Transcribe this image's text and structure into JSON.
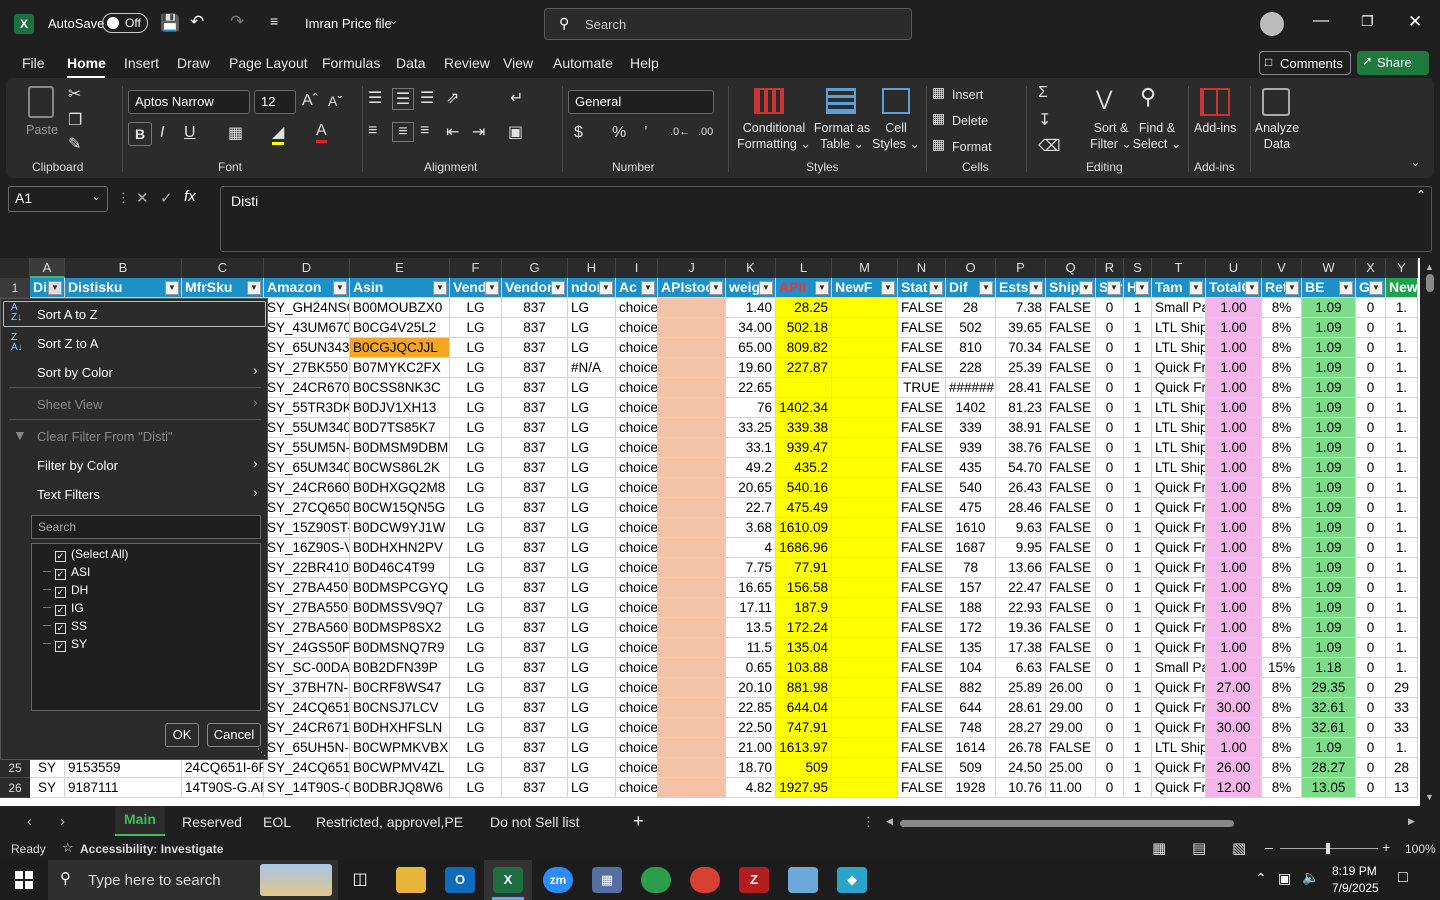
{
  "title": {
    "autosave": "AutoSave",
    "autosave_state": "Off",
    "filename": "Imran Price file",
    "search_placeholder": "Search"
  },
  "menu": [
    "File",
    "Home",
    "Insert",
    "Draw",
    "Page Layout",
    "Formulas",
    "Data",
    "Review",
    "View",
    "Automate",
    "Help"
  ],
  "actions": {
    "comments": "Comments",
    "share": "Share"
  },
  "ribbon": {
    "clipboard": {
      "paste": "Paste",
      "group": "Clipboard"
    },
    "font": {
      "name": "Aptos Narrow",
      "size": "12",
      "group": "Font"
    },
    "alignment": {
      "group": "Alignment"
    },
    "number": {
      "format": "General",
      "group": "Number"
    },
    "styles": {
      "cond1": "Conditional",
      "cond2": "Formatting",
      "fat1": "Format as",
      "fat2": "Table",
      "cs1": "Cell",
      "cs2": "Styles",
      "group": "Styles"
    },
    "cells": {
      "insert": "Insert",
      "delete": "Delete",
      "format": "Format",
      "group": "Cells"
    },
    "editing": {
      "sf1": "Sort &",
      "sf2": "Filter",
      "fs1": "Find &",
      "fs2": "Select",
      "group": "Editing"
    },
    "addins": {
      "label": "Add-ins",
      "group": "Add-ins"
    },
    "analyze": {
      "l1": "Analyze",
      "l2": "Data"
    }
  },
  "formula": {
    "namebox": "A1",
    "content": "Disti"
  },
  "columns": [
    {
      "l": "A",
      "w": 35,
      "h": "Dis"
    },
    {
      "l": "B",
      "w": 117,
      "h": "Distisku"
    },
    {
      "l": "C",
      "w": 82,
      "h": "MfrSku"
    },
    {
      "l": "D",
      "w": 86,
      "h": "Amazon"
    },
    {
      "l": "E",
      "w": 100,
      "h": "Asin"
    },
    {
      "l": "F",
      "w": 52,
      "h": "Vend"
    },
    {
      "l": "G",
      "w": 66,
      "h": "Vendor"
    },
    {
      "l": "H",
      "w": 48,
      "h": "ndor"
    },
    {
      "l": "I",
      "w": 42,
      "h": "Ac"
    },
    {
      "l": "J",
      "w": 68,
      "h": "APIstoc"
    },
    {
      "l": "K",
      "w": 50,
      "h": "weig"
    },
    {
      "l": "L",
      "w": 56,
      "h": "APII"
    },
    {
      "l": "M",
      "w": 66,
      "h": "NewF"
    },
    {
      "l": "N",
      "w": 48,
      "h": "Stat"
    },
    {
      "l": "O",
      "w": 50,
      "h": "Dif"
    },
    {
      "l": "P",
      "w": 50,
      "h": "Ests"
    },
    {
      "l": "Q",
      "w": 50,
      "h": "Ship"
    },
    {
      "l": "R",
      "w": 28,
      "h": "Sur"
    },
    {
      "l": "S",
      "w": 28,
      "h": "H"
    },
    {
      "l": "T",
      "w": 54,
      "h": "Tam"
    },
    {
      "l": "U",
      "w": 56,
      "h": "TotalC"
    },
    {
      "l": "V",
      "w": 40,
      "h": "Ref"
    },
    {
      "l": "W",
      "w": 54,
      "h": "BE"
    },
    {
      "l": "X",
      "w": 30,
      "h": "GI"
    },
    {
      "l": "Y",
      "w": 32,
      "h": "New"
    }
  ],
  "rows": [
    {
      "n": "2",
      "c": [
        "",
        "",
        "",
        "SY_GH24NSC0",
        "B00MOUBZX0",
        "LG",
        "837",
        "LG",
        "choice",
        "",
        "1.40",
        "28.25",
        "",
        "FALSE",
        "28",
        "7.38",
        "FALSE",
        "0",
        "1",
        "Small Pa",
        "1.00",
        "8%",
        "1.09",
        "0",
        "1."
      ]
    },
    {
      "n": "3",
      "c": [
        "",
        "",
        "",
        "SY_43UM670H",
        "B0CG4V25L2",
        "LG",
        "837",
        "LG",
        "choice",
        "",
        "34.00",
        "502.18",
        "",
        "FALSE",
        "502",
        "39.65",
        "FALSE",
        "0",
        "1",
        "LTL Ship",
        "1.00",
        "8%",
        "1.09",
        "0",
        "1."
      ]
    },
    {
      "n": "4",
      "c": [
        "",
        "",
        "",
        "SY_65UN343H",
        "B0CGJQCJJL",
        "LG",
        "837",
        "LG",
        "choice",
        "",
        "65.00",
        "809.82",
        "",
        "FALSE",
        "810",
        "70.34",
        "FALSE",
        "0",
        "1",
        "LTL Ship",
        "1.00",
        "8%",
        "1.09",
        "0",
        "1."
      ]
    },
    {
      "n": "5",
      "c": [
        "",
        "",
        "",
        "SY_27BK550Y-",
        "B07MYKC2FX",
        "LG",
        "837",
        "#N/A",
        "choice",
        "",
        "19.60",
        "227.87",
        "",
        "FALSE",
        "228",
        "25.39",
        "FALSE",
        "0",
        "1",
        "Quick Fr",
        "1.00",
        "8%",
        "1.09",
        "0",
        "1."
      ]
    },
    {
      "n": "6",
      "c": [
        "",
        "",
        "",
        "SY_24CR670IK",
        "B0CSS8NK3C",
        "LG",
        "837",
        "LG",
        "choice",
        "",
        "22.65",
        "",
        "",
        "TRUE",
        "######",
        "28.41",
        "FALSE",
        "0",
        "1",
        "Quick Fr",
        "1.00",
        "8%",
        "1.09",
        "0",
        "1."
      ]
    },
    {
      "n": "7",
      "c": [
        "",
        "",
        "",
        "SY_55TR3DK-E",
        "B0DJV1XH13",
        "LG",
        "837",
        "LG",
        "choice",
        "",
        "76",
        "1402.34",
        "",
        "FALSE",
        "1402",
        "81.23",
        "FALSE",
        "0",
        "1",
        "LTL Ship",
        "1.00",
        "8%",
        "1.09",
        "0",
        "1."
      ]
    },
    {
      "n": "8",
      "c": [
        "",
        "",
        "",
        "SY_55UM340E",
        "B0D7TS85K7",
        "LG",
        "837",
        "LG",
        "choice",
        "",
        "33.25",
        "339.38",
        "",
        "FALSE",
        "339",
        "38.91",
        "FALSE",
        "0",
        "1",
        "LTL Ship",
        "1.00",
        "8%",
        "1.09",
        "0",
        "1."
      ]
    },
    {
      "n": "9",
      "c": [
        "",
        "",
        "",
        "SY_55UM5N-E",
        "B0DMSM9DBM",
        "LG",
        "837",
        "LG",
        "choice",
        "",
        "33.1",
        "939.47",
        "",
        "FALSE",
        "939",
        "38.76",
        "FALSE",
        "0",
        "1",
        "LTL Ship",
        "1.00",
        "8%",
        "1.09",
        "0",
        "1."
      ]
    },
    {
      "n": "10",
      "c": [
        "",
        "",
        "",
        "SY_65UM340E",
        "B0CWS86L2K",
        "LG",
        "837",
        "LG",
        "choice",
        "",
        "49.2",
        "435.2",
        "",
        "FALSE",
        "435",
        "54.70",
        "FALSE",
        "0",
        "1",
        "LTL Ship",
        "1.00",
        "8%",
        "1.09",
        "0",
        "1."
      ]
    },
    {
      "n": "11",
      "c": [
        "",
        "",
        "",
        "SY_24CR660N",
        "B0DHXGQ2M8",
        "LG",
        "837",
        "LG",
        "choice",
        "",
        "20.65",
        "540.16",
        "",
        "FALSE",
        "540",
        "26.43",
        "FALSE",
        "0",
        "1",
        "Quick Fr",
        "1.00",
        "8%",
        "1.09",
        "0",
        "1."
      ]
    },
    {
      "n": "12",
      "c": [
        "",
        "",
        "",
        "SY_27CQ650N",
        "B0CW15QN5G",
        "LG",
        "837",
        "LG",
        "choice",
        "",
        "22.7",
        "475.49",
        "",
        "FALSE",
        "475",
        "28.46",
        "FALSE",
        "0",
        "1",
        "Quick Fr",
        "1.00",
        "8%",
        "1.09",
        "0",
        "1."
      ]
    },
    {
      "n": "13",
      "c": [
        "",
        "",
        "",
        "SY_15Z90ST-V",
        "B0DCW9YJ1W",
        "LG",
        "837",
        "LG",
        "choice",
        "",
        "3.68",
        "1610.09",
        "",
        "FALSE",
        "1610",
        "9.63",
        "FALSE",
        "0",
        "1",
        "Quick Fr",
        "1.00",
        "8%",
        "1.09",
        "0",
        "1."
      ]
    },
    {
      "n": "14",
      "c": [
        "",
        "",
        "",
        "SY_16Z90S-V.A",
        "B0DHXHN2PV",
        "LG",
        "837",
        "LG",
        "choice",
        "",
        "4",
        "1686.96",
        "",
        "FALSE",
        "1687",
        "9.95",
        "FALSE",
        "0",
        "1",
        "Quick Fr",
        "1.00",
        "8%",
        "1.09",
        "0",
        "1."
      ]
    },
    {
      "n": "15",
      "c": [
        "",
        "",
        "",
        "SY_22BR410-E",
        "B0D46C4T99",
        "LG",
        "837",
        "LG",
        "choice",
        "",
        "7.75",
        "77.91",
        "",
        "FALSE",
        "78",
        "13.66",
        "FALSE",
        "0",
        "1",
        "Quick Fr",
        "1.00",
        "8%",
        "1.09",
        "0",
        "1."
      ]
    },
    {
      "n": "16",
      "c": [
        "",
        "",
        "",
        "SY_27BA450-E",
        "B0DMSPCGYQ",
        "LG",
        "837",
        "LG",
        "choice",
        "",
        "16.65",
        "156.58",
        "",
        "FALSE",
        "157",
        "22.47",
        "FALSE",
        "0",
        "1",
        "Quick Fr",
        "1.00",
        "8%",
        "1.09",
        "0",
        "1."
      ]
    },
    {
      "n": "17",
      "c": [
        "",
        "",
        "",
        "SY_27BA550-E",
        "B0DMSSV9Q7",
        "LG",
        "837",
        "LG",
        "choice",
        "",
        "17.11",
        "187.9",
        "",
        "FALSE",
        "188",
        "22.93",
        "FALSE",
        "0",
        "1",
        "Quick Fr",
        "1.00",
        "8%",
        "1.09",
        "0",
        "1."
      ]
    },
    {
      "n": "18",
      "c": [
        "",
        "",
        "",
        "SY_27BA560-E",
        "B0DMSP8SX2",
        "LG",
        "837",
        "LG",
        "choice",
        "",
        "13.5",
        "172.24",
        "",
        "FALSE",
        "172",
        "19.36",
        "FALSE",
        "0",
        "1",
        "Quick Fr",
        "1.00",
        "8%",
        "1.09",
        "0",
        "1."
      ]
    },
    {
      "n": "19",
      "c": [
        "",
        "",
        "",
        "SY_24GS50FX-",
        "B0DMSNQ7R9",
        "LG",
        "837",
        "LG",
        "choice",
        "",
        "11.5",
        "135.04",
        "",
        "FALSE",
        "135",
        "17.38",
        "FALSE",
        "0",
        "1",
        "Quick Fr",
        "1.00",
        "8%",
        "1.09",
        "0",
        "1."
      ]
    },
    {
      "n": "20",
      "c": [
        "",
        "",
        "",
        "SY_SC-00DA",
        "B0B2DFN39P",
        "LG",
        "837",
        "LG",
        "choice",
        "",
        "0.65",
        "103.88",
        "",
        "FALSE",
        "104",
        "6.63",
        "FALSE",
        "0",
        "1",
        "Small Pa",
        "1.00",
        "15%",
        "1.18",
        "0",
        "1."
      ]
    },
    {
      "n": "21",
      "c": [
        "",
        "",
        "",
        "SY_37BH7N-H",
        "B0CRF8WS47",
        "LG",
        "837",
        "LG",
        "choice",
        "",
        "20.10",
        "881.98",
        "",
        "FALSE",
        "882",
        "25.89",
        "26.00",
        "0",
        "1",
        "Quick Fr",
        "27.00",
        "8%",
        "29.35",
        "0",
        "29"
      ]
    },
    {
      "n": "22",
      "c": [
        "",
        "",
        "",
        "SY_24CQ651W",
        "B0CNSJ7LCV",
        "LG",
        "837",
        "LG",
        "choice",
        "",
        "22.85",
        "644.04",
        "",
        "FALSE",
        "644",
        "28.61",
        "29.00",
        "0",
        "1",
        "Quick Fr",
        "30.00",
        "8%",
        "32.61",
        "0",
        "33"
      ]
    },
    {
      "n": "23",
      "c": [
        "",
        "",
        "",
        "SY_24CR671IK",
        "B0DHXHFSLN",
        "LG",
        "837",
        "LG",
        "choice",
        "",
        "22.50",
        "747.91",
        "",
        "FALSE",
        "748",
        "28.27",
        "29.00",
        "0",
        "1",
        "Quick Fr",
        "30.00",
        "8%",
        "32.61",
        "0",
        "33"
      ]
    },
    {
      "n": "24",
      "c": [
        "",
        "",
        "",
        "SY_65UH5N-E",
        "B0CWPMKVBX",
        "LG",
        "837",
        "LG",
        "choice",
        "",
        "21.00",
        "1613.97",
        "",
        "FALSE",
        "1614",
        "26.78",
        "FALSE",
        "0",
        "1",
        "LTL Ship",
        "1.00",
        "8%",
        "1.09",
        "0",
        "1."
      ]
    },
    {
      "n": "25",
      "c": [
        "SY",
        "9153559",
        "24CQ651I-6P",
        "SY_24CQ651I-",
        "B0CWPMV4ZL",
        "LG",
        "837",
        "LG",
        "choice",
        "",
        "18.70",
        "509",
        "",
        "FALSE",
        "509",
        "24.50",
        "25.00",
        "0",
        "1",
        "Quick Fr",
        "26.00",
        "8%",
        "28.27",
        "0",
        "28"
      ]
    },
    {
      "n": "26",
      "c": [
        "SY",
        "9187111",
        "14T90S-G.AP",
        "SY_14T90S-G.",
        "B0DBRJQ8W6",
        "LG",
        "837",
        "LG",
        "choice",
        "",
        "4.82",
        "1927.95",
        "",
        "FALSE",
        "1928",
        "10.76",
        "11.00",
        "0",
        "1",
        "Quick Fr",
        "12.00",
        "8%",
        "13.05",
        "0",
        "13"
      ]
    }
  ],
  "filter_menu": {
    "items": [
      {
        "label": "Sort A to Z",
        "enabled": true
      },
      {
        "label": "Sort Z to A",
        "enabled": true
      },
      {
        "label": "Sort by Color",
        "enabled": true
      },
      {
        "label": "Sheet View",
        "enabled": false
      },
      {
        "label": "Clear Filter From \"Disti\"",
        "enabled": false
      },
      {
        "label": "Filter by Color",
        "enabled": true
      },
      {
        "label": "Text Filters",
        "enabled": true
      }
    ],
    "search_placeholder": "Search",
    "values": [
      "(Select All)",
      "ASI",
      "DH",
      "IG",
      "SS",
      "SY"
    ],
    "ok": "OK",
    "cancel": "Cancel"
  },
  "sheets": [
    "Main",
    "Reserved",
    "EOL",
    "Restricted, approvel,PE",
    "Do not Sell list"
  ],
  "status": {
    "ready": "Ready",
    "accessibility": "Accessibility: Investigate",
    "zoom": "100%"
  },
  "taskbar": {
    "search_placeholder": "Type here to search",
    "time": "8:19 PM",
    "date": "7/9/2025"
  },
  "colors": {
    "header_blue": "#1e90c8",
    "api_yellow": "#ffff00",
    "salmon": "#f4c2a6",
    "pink": "#f4b6e8",
    "green": "#7ddc8a",
    "share_green": "#1f7a3d"
  }
}
